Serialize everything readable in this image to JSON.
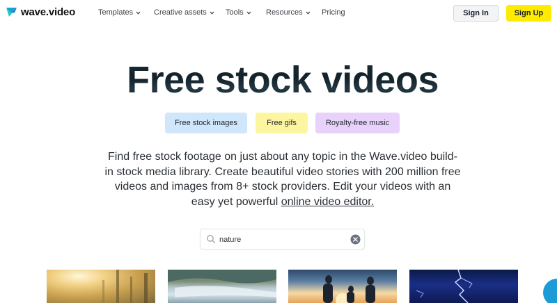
{
  "brand": {
    "name": "wave.video",
    "accent": "#ffeb00"
  },
  "nav": {
    "items": [
      {
        "label": "Templates",
        "has_dropdown": true
      },
      {
        "label": "Creative assets",
        "has_dropdown": true
      },
      {
        "label": "Tools",
        "has_dropdown": true
      },
      {
        "label": "Resources",
        "has_dropdown": true
      },
      {
        "label": "Pricing",
        "has_dropdown": false
      }
    ],
    "sign_in": "Sign In",
    "sign_up": "Sign Up"
  },
  "hero": {
    "title": "Free stock videos",
    "chips": [
      {
        "label": "Free stock images",
        "color": "#cfe6fb"
      },
      {
        "label": "Free gifs",
        "color": "#fcf6a0"
      },
      {
        "label": "Royalty-free music",
        "color": "#e8d2fb"
      }
    ],
    "description": "Find free stock footage on just about any topic in the Wave.video build-in stock media library. Create beautiful video stories with 200 million free videos and images from 8+ stock providers. Edit your videos with an easy yet powerful ",
    "description_link": "online video editor."
  },
  "search": {
    "value": "nature",
    "icon": "search-icon",
    "clear_icon": "clear-icon"
  },
  "thumbnails": [
    {
      "name": "sunlit-forest"
    },
    {
      "name": "river-waterfall"
    },
    {
      "name": "family-sunset"
    },
    {
      "name": "lightning-storm"
    }
  ],
  "chat": {
    "icon": "chat-icon",
    "color": "#1d9bd7"
  }
}
